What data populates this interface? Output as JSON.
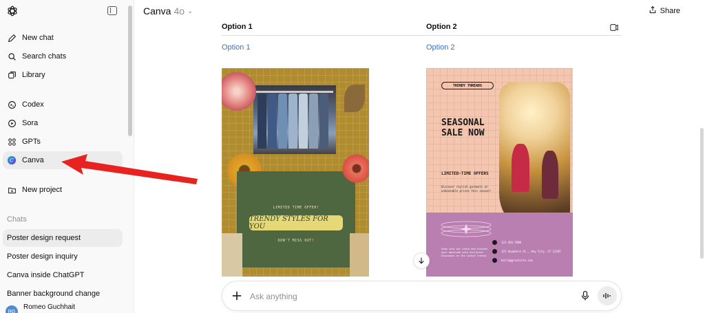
{
  "sidebar": {
    "nav": [
      {
        "label": "New chat",
        "icon": "edit-icon"
      },
      {
        "label": "Search chats",
        "icon": "search-icon"
      },
      {
        "label": "Library",
        "icon": "library-icon"
      }
    ],
    "apps": [
      {
        "label": "Codex",
        "icon": "codex-icon"
      },
      {
        "label": "Sora",
        "icon": "sora-icon"
      },
      {
        "label": "GPTs",
        "icon": "gpts-icon"
      },
      {
        "label": "Canva",
        "icon": "canva-icon"
      }
    ],
    "new_project": "New project",
    "chats_heading": "Chats",
    "chats": [
      "Poster design request",
      "Poster design inquiry",
      "Canva inside ChatGPT",
      "Banner background change"
    ],
    "user": {
      "initials": "RG",
      "name": "Romeo Guchhait"
    }
  },
  "header": {
    "model": "Canva",
    "version": "4o",
    "share_label": "Share"
  },
  "table": {
    "headers": [
      "Option 1",
      "Option 2"
    ],
    "links": [
      "Option 1",
      "Option 2"
    ]
  },
  "poster1": {
    "top_text": "LIMITED TIME OFFER!",
    "banner": "TRENDY STYLES FOR YOU",
    "bottom_text": "DON'T MISS OUT!"
  },
  "poster2": {
    "tag": "TRENDY THREADS",
    "title": "SEASONAL SALE NOW",
    "offer": "LIMITED-TIME OFFERS",
    "desc": "Discover stylish garments at unbeatable prices this season!",
    "blurb": "Step into our store and elevate your wardrobe with exclusive discounts on the latest trends.",
    "contacts": [
      "123-456-7890",
      "123 Anywhere St., Any City, ST 12345",
      "hello@greatsite.com"
    ]
  },
  "composer": {
    "placeholder": "Ask anything"
  },
  "colors": {
    "sidebar_bg": "#f9f9f9",
    "active_bg": "#ececec",
    "link": "#3b6fc7",
    "arrow": "#e8231f"
  }
}
